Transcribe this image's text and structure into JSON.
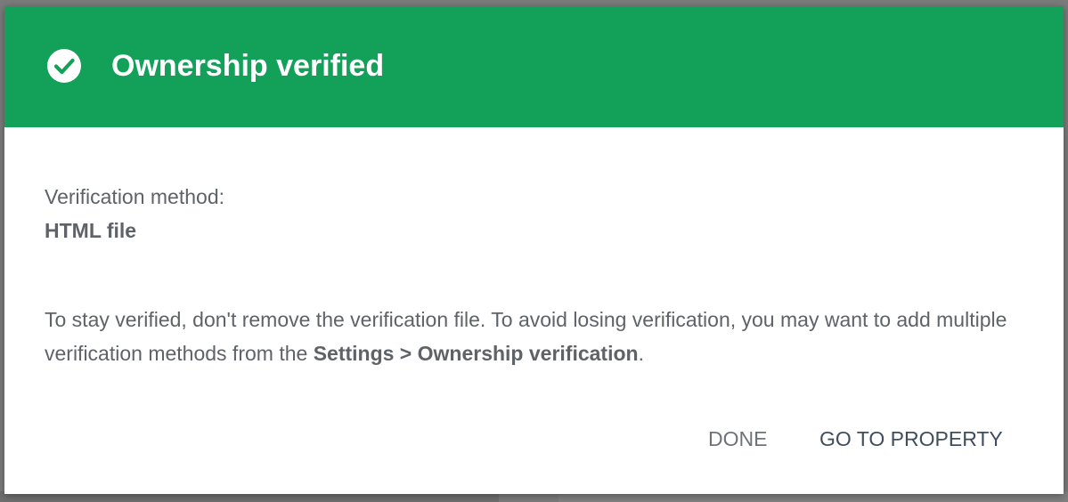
{
  "dialog": {
    "title": "Ownership verified",
    "header_color": "#13a058",
    "header_icon": "check-circle-icon",
    "method_label": "Verification method:",
    "method_value": "HTML file",
    "info_text_part1": "To stay verified, don't remove the verification file. To avoid losing verification, you may want to add multiple verification methods from the ",
    "info_text_link": "Settings > Ownership verification",
    "info_text_part2": ".",
    "buttons": {
      "done_label": "DONE",
      "go_to_property_label": "GO TO PROPERTY"
    }
  }
}
